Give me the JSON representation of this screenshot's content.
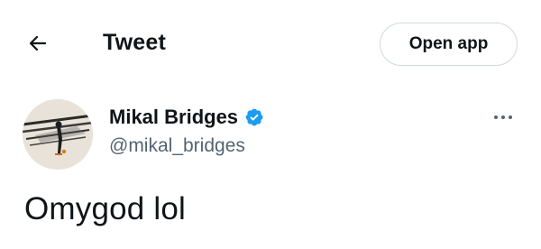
{
  "header": {
    "back_icon": "arrow-left-icon",
    "title": "Tweet",
    "open_app_label": "Open app"
  },
  "tweet": {
    "author": {
      "name": "Mikal Bridges",
      "handle": "@mikal_bridges",
      "verified": true,
      "verified_icon": "verified-badge-icon"
    },
    "more_icon": "more-options-icon",
    "text": "Omygod lol"
  },
  "colors": {
    "text_primary": "#0f1419",
    "text_secondary": "#536471",
    "border": "#cfd9de",
    "verified_blue": "#1d9bf0"
  }
}
